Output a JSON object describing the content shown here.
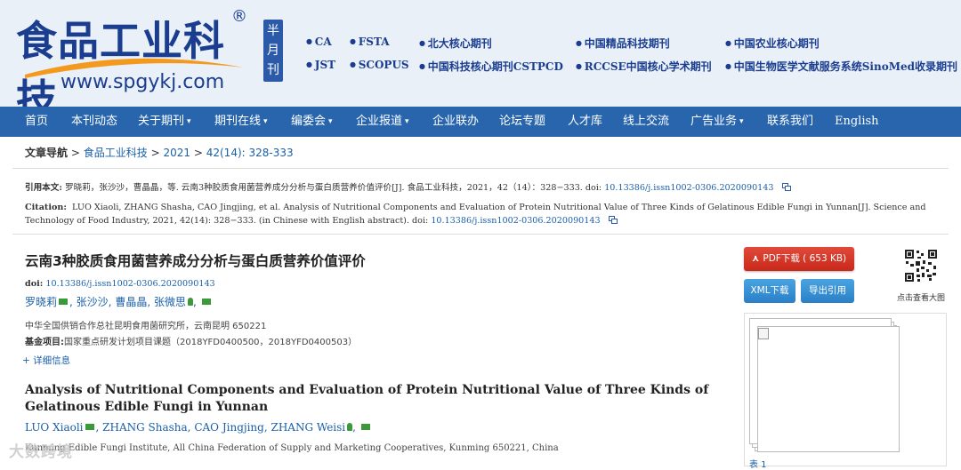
{
  "header": {
    "logo_text": "食品工业科技",
    "registered": "®",
    "url": "www.spgykj.com",
    "frequency": "半月刊",
    "indexes": [
      "CA",
      "FSTA",
      "北大核心期刊",
      "中国精品科技期刊",
      "中国农业核心期刊",
      "JST",
      "SCOPUS",
      "中国科技核心期刊CSTPCD",
      "RCCSE中国核心学术期刊",
      "中国生物医学文献服务系统SinoMed收录期刊"
    ]
  },
  "nav": {
    "items": [
      "首页",
      "本刊动态",
      "关于期刊",
      "期刊在线",
      "编委会",
      "企业报道",
      "企业联办",
      "论坛专题",
      "人才库",
      "线上交流",
      "广告业务",
      "联系我们",
      "English"
    ]
  },
  "breadcrumb": {
    "label": "文章导航",
    "sep": ">",
    "journal": "食品工业科技",
    "year": "2021",
    "issue": "42(14): 328-333"
  },
  "citation": {
    "cn_label": "引用本文:",
    "cn_text": "罗晓莉，张沙沙，曹晶晶，等. 云南3种胶质食用菌营养成分分析与蛋白质营养价值评价[J]. 食品工业科技，2021，42（14）：328−333. doi:",
    "cn_doi": "10.13386/j.issn1002-0306.2020090143",
    "en_label": "Citation:",
    "en_text": "LUO Xiaoli, ZHANG Shasha, CAO Jingjing, et al. Analysis of Nutritional Components and Evaluation of Protein Nutritional Value of Three Kinds of Gelatinous Edible Fungi in Yunnan[J]. Science and Technology of Food Industry, 2021, 42(14): 328−333. (in Chinese with English abstract). doi:",
    "en_doi": "10.13386/j.issn1002-0306.2020090143"
  },
  "article": {
    "title": "云南3种胶质食用菌营养成分分析与蛋白质营养价值评价",
    "doi_label": "doi:",
    "doi": "10.13386/j.issn1002-0306.2020090143",
    "authors_cn": [
      "罗晓莉",
      "张沙沙",
      "曹晶晶",
      "张微思"
    ],
    "affiliation_cn": "中华全国供销合作总社昆明食用菌研究所，云南昆明 650221",
    "fund_label": "基金项目:",
    "fund": "国家重点研发计划项目课题（2018YFD0400500，2018YFD0400503）",
    "more_info": "+ 详细信息",
    "title_en": "Analysis of Nutritional Components and Evaluation of Protein Nutritional Value of Three Kinds of Gelatinous Edible Fungi in Yunnan",
    "authors_en": [
      "LUO Xiaoli",
      "ZHANG Shasha",
      "CAO Jingjing",
      "ZHANG Weisi"
    ],
    "affiliation_en": "Kunming Edible Fungi Institute, All China Federation of Supply and Marketing Cooperatives, Kunming 650221, China"
  },
  "side": {
    "pdf_button": "PDF下载 ( 653 KB)",
    "xml_button": "XML下载",
    "export_button": "导出引用",
    "qr_label": "点击查看大图",
    "foot": "表 1"
  },
  "watermark": "大数跨境",
  "colors": {
    "nav": "#2865ad",
    "header_bg": "#e9f0f8",
    "link": "#1a5fa8",
    "pdf": "#d6372a"
  }
}
